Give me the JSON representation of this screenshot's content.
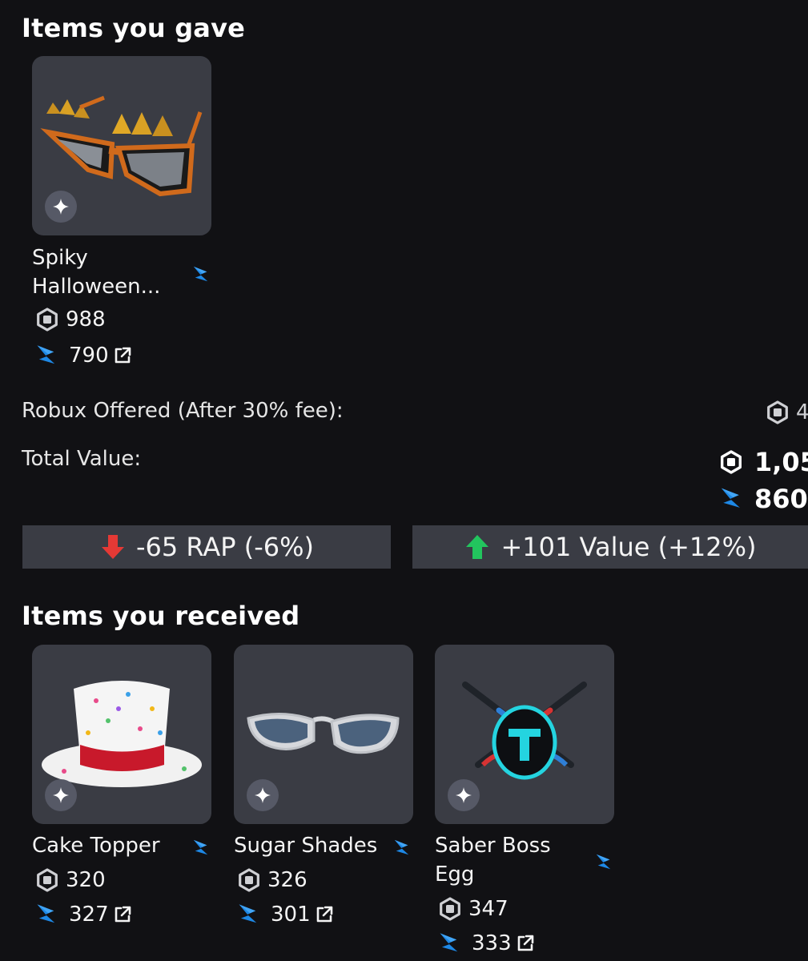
{
  "gave": {
    "title": "Items you gave",
    "items": [
      {
        "name_line1": "Spiky",
        "name_line2": "Halloween...",
        "rap": "988",
        "value": "790"
      }
    ]
  },
  "summary": {
    "robux_label": "Robux Offered (After 30% fee):",
    "robux_value": "4",
    "total_label": "Total Value:",
    "total_rap": "1,05",
    "total_value": "860"
  },
  "deltas": {
    "rap": "-65 RAP (-6%)",
    "value": "+101 Value (+12%)"
  },
  "received": {
    "title": "Items you received",
    "items": [
      {
        "name_line1": "Cake Topper",
        "name_line2": "",
        "rap": "320",
        "value": "327"
      },
      {
        "name_line1": "Sugar Shades",
        "name_line2": "",
        "rap": "326",
        "value": "301"
      },
      {
        "name_line1": "Saber Boss",
        "name_line2": "Egg",
        "rap": "347",
        "value": "333"
      }
    ]
  },
  "icons": {
    "rap": "robux-hexagon-icon",
    "value": "rolimons-bolt-icon",
    "external": "external-link-icon",
    "sparkle": "sparkle-icon"
  },
  "colors": {
    "background": "#111114",
    "card": "#3a3c44",
    "bolt_blue": "#1e88e5",
    "down_red": "#e53935",
    "up_green": "#22c55e"
  }
}
